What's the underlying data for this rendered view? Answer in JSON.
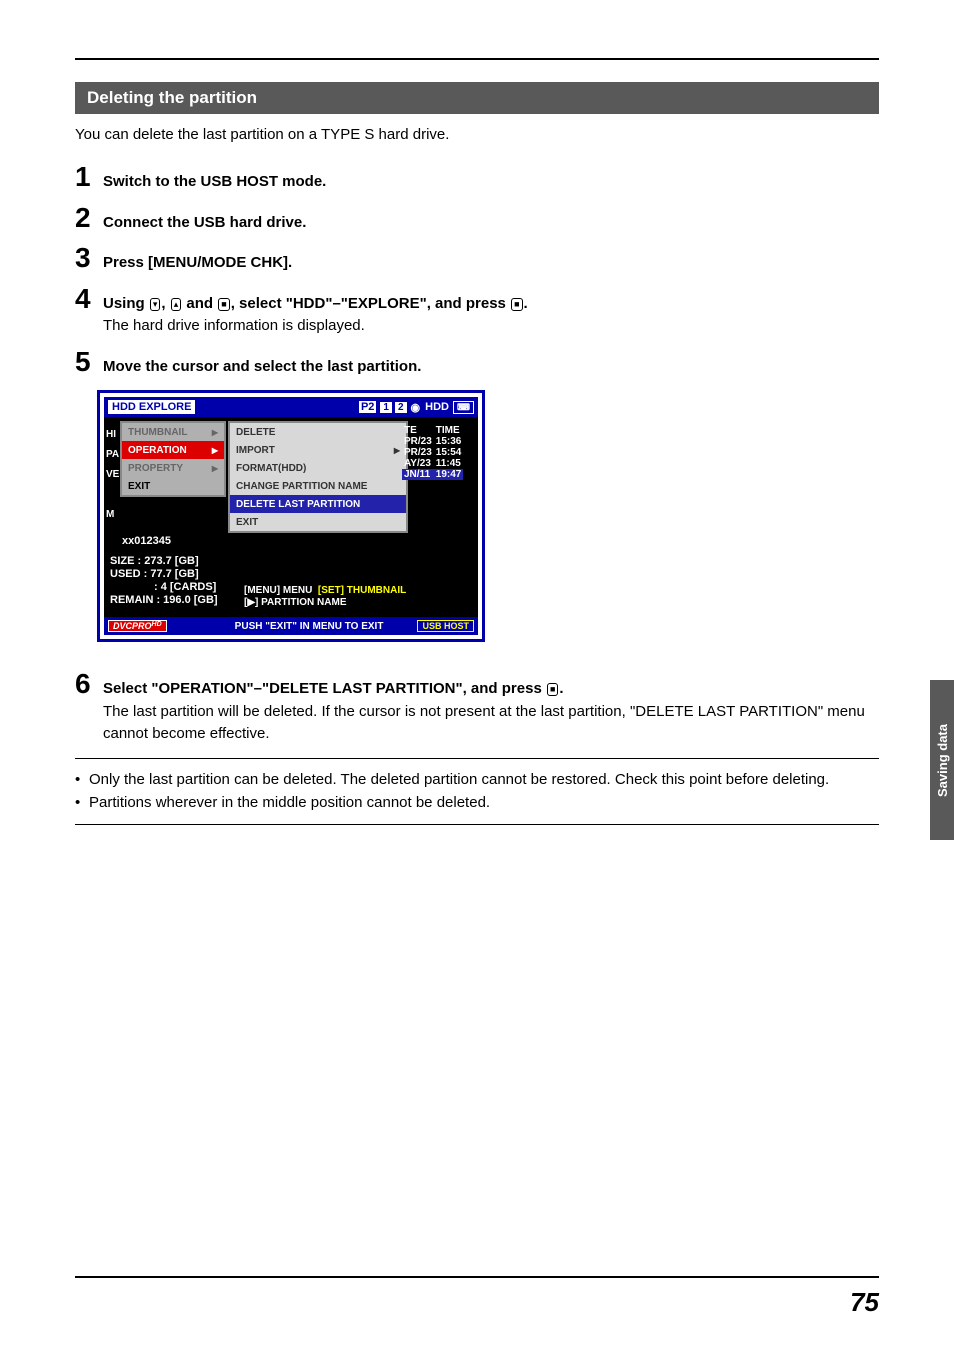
{
  "page_number": "75",
  "side_tab": "Saving data",
  "section_heading": "Deleting the partition",
  "intro": "You can delete the last partition on a TYPE S hard drive.",
  "steps": {
    "s1": {
      "num": "1",
      "bold": "Switch to the USB HOST mode."
    },
    "s2": {
      "num": "2",
      "bold": "Connect the USB hard drive."
    },
    "s3": {
      "num": "3",
      "bold": "Press [MENU/MODE CHK]."
    },
    "s4": {
      "num": "4",
      "bold_a": "Using ",
      "bold_b": ", ",
      "bold_c": " and ",
      "bold_d": ", select \"HDD\"–\"EXPLORE\", and press ",
      "bold_e": ".",
      "sub": "The hard drive information is displayed."
    },
    "s5": {
      "num": "5",
      "bold": "Move the cursor and select the last partition."
    },
    "s6": {
      "num": "6",
      "bold_a": "Select \"OPERATION\"–\"DELETE LAST PARTITION\", and press ",
      "bold_b": ".",
      "sub": "The last partition will be deleted. If the cursor is not present at the last partition, \"DELETE LAST PARTITION\" menu cannot become effective."
    }
  },
  "icons": {
    "down": "▾",
    "up": "▴",
    "set": "■"
  },
  "notes": {
    "n1": "Only the last partition can be deleted. The deleted partition cannot be restored. Check this point before deleting.",
    "n2": "Partitions wherever in the middle position cannot be deleted."
  },
  "screenshot": {
    "title": "HDD EXPLORE",
    "p2": "P2",
    "slot1": "1",
    "slot2": "2",
    "hdd": "HDD",
    "left_letters": [
      "HI",
      "PA",
      "VE",
      "",
      "M"
    ],
    "menu1": [
      {
        "label": "THUMBNAIL",
        "sel": false
      },
      {
        "label": "OPERATION",
        "sel": true
      },
      {
        "label": "PROPERTY",
        "sel": false
      },
      {
        "label": "EXIT",
        "sel": false,
        "exit": true
      }
    ],
    "menu2": [
      {
        "label": "DELETE"
      },
      {
        "label": "IMPORT",
        "arrow": true
      },
      {
        "label": "FORMAT(HDD)"
      },
      {
        "label": "CHANGE PARTITION NAME"
      },
      {
        "label": "DELETE LAST PARTITION",
        "hl": true
      },
      {
        "label": "EXIT"
      }
    ],
    "serial": "xx012345",
    "stats": {
      "size": "SIZE : 273.7 [GB]",
      "used": "USED :  77.7 [GB]",
      "cards": ": 4 [CARDS]",
      "remain": "REMAIN : 196.0 [GB]"
    },
    "hints": {
      "line1a": "[MENU] MENU",
      "line1b": "[SET] THUMBNAIL",
      "line2": "[▶] PARTITION NAME"
    },
    "right_header": {
      "c1": "TE",
      "c2": "TIME"
    },
    "right_rows": [
      {
        "c1": "PR/23",
        "c2": "15:36"
      },
      {
        "c1": "PR/23",
        "c2": "15:54"
      },
      {
        "c1": "AY/23",
        "c2": "11:45"
      },
      {
        "c1": "JN/11",
        "c2": "19:47",
        "sel": true
      }
    ],
    "footer": {
      "dvcpro": "DVCPRO",
      "hd": "HD",
      "push": "PUSH \"EXIT\" IN MENU TO EXIT",
      "usbhost": "USB HOST"
    }
  }
}
